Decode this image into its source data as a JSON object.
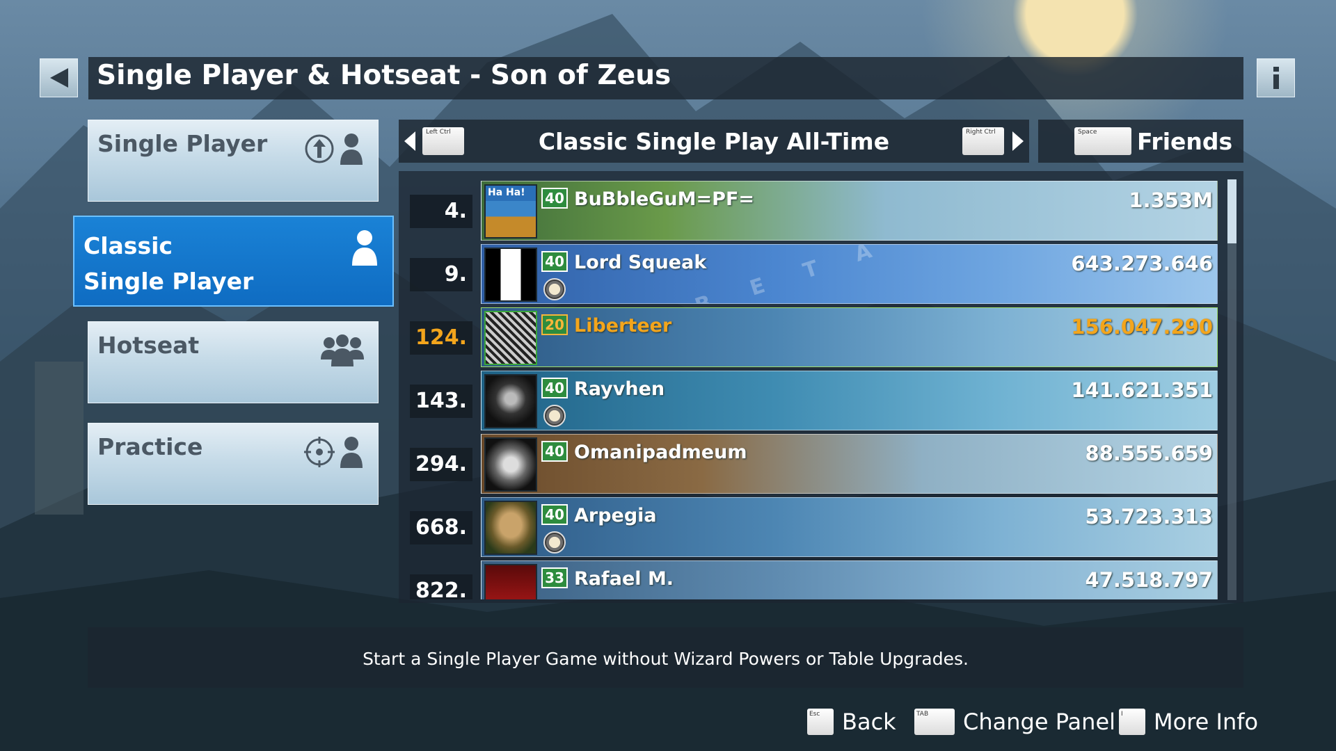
{
  "header": {
    "title": "Single Player & Hotseat - Son of Zeus"
  },
  "menu": {
    "items": [
      {
        "label": "Single Player",
        "icons": [
          "upgrade-icon",
          "player-icon"
        ]
      },
      {
        "label_line1": "Classic",
        "label_line2": "Single Player",
        "icons": [
          "player-icon"
        ],
        "active": true
      },
      {
        "label": "Hotseat",
        "icons": [
          "group-icon"
        ]
      },
      {
        "label": "Practice",
        "icons": [
          "target-icon",
          "player-icon"
        ]
      }
    ]
  },
  "leaderboard": {
    "left_key": "Left Ctrl",
    "right_key": "Right Ctrl",
    "title": "Classic Single Play All-Time",
    "friends_key": "Space",
    "friends_label": "Friends",
    "rows": [
      {
        "rank": "4.",
        "level": "40",
        "name": "BuBbleGuM=PF=",
        "score": "1.353M",
        "avatar_text": "Ha Ha!"
      },
      {
        "rank": "9.",
        "level": "40",
        "name": "Lord Squeak",
        "score": "643.273.646",
        "banner": "BETA"
      },
      {
        "rank": "124.",
        "level": "20",
        "name": "Liberteer",
        "score": "156.047.290",
        "highlight": true
      },
      {
        "rank": "143.",
        "level": "40",
        "name": "Rayvhen",
        "score": "141.621.351"
      },
      {
        "rank": "294.",
        "level": "40",
        "name": "Omanipadmeum",
        "score": "88.555.659"
      },
      {
        "rank": "668.",
        "level": "40",
        "name": "Arpegia",
        "score": "53.723.313"
      },
      {
        "rank": "822.",
        "level": "33",
        "name": "Rafael M.",
        "score": "47.518.797"
      }
    ]
  },
  "description": "Start a Single Player Game without Wizard Powers or Table Upgrades.",
  "footer": {
    "back_key": "Esc",
    "back_label": "Back",
    "panel_key": "TAB",
    "panel_label": "Change Panel",
    "info_key": "I",
    "info_label": "More Info"
  },
  "colors": {
    "accent_blue": "#0f6cc2",
    "gold": "#f3a51c",
    "level_green": "#2e8c3e"
  }
}
